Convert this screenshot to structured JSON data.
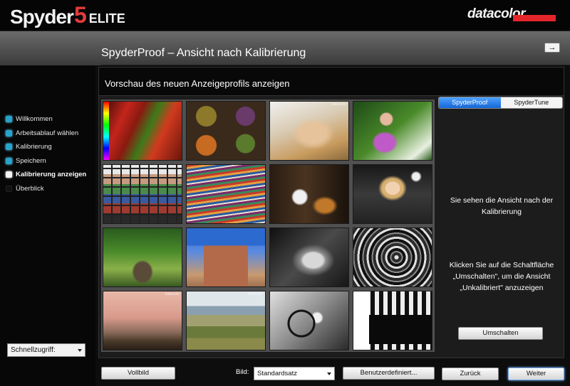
{
  "header": {
    "logo_word": "Spyder",
    "logo_number": "5",
    "logo_edition": "ELITE",
    "brand": "datacolor"
  },
  "titlebar": {
    "title": "SpyderProof – Ansicht nach Kalibrierung",
    "arrow_icon": "→"
  },
  "sidebar": {
    "steps": [
      {
        "label": "Willkommen",
        "state": "done"
      },
      {
        "label": "Arbeitsablauf wählen",
        "state": "done"
      },
      {
        "label": "Kalibrierung",
        "state": "done"
      },
      {
        "label": "Speichern",
        "state": "done"
      },
      {
        "label": "Kalibrierung anzeigen",
        "state": "current"
      },
      {
        "label": "Überblick",
        "state": "pending"
      }
    ],
    "quick_access": "Schnellzugriff:"
  },
  "main": {
    "subtitle": "Vorschau des neuen Anzeigeprofils anzeigen",
    "watermark": "datacolor"
  },
  "right_panel": {
    "tabs": [
      "SpyderProof",
      "SpyderTune"
    ],
    "active_tab": "SpyderProof",
    "info_1": "Sie sehen die Ansicht nach der Kalibrierung",
    "info_2": "Klicken Sie auf die Schaltfläche „Umschalten\", um die Ansicht „Unkalibriert\" anzuzeigen",
    "toggle_button": "Umschalten"
  },
  "footer": {
    "fullscreen_button": "Vollbild",
    "image_label": "Bild:",
    "image_select": "Standardsatz",
    "custom_button": "Benutzerdefiniert...",
    "back_button": "Zurück",
    "next_button": "Weiter"
  },
  "colors": {
    "accent_blue": "#1466d6",
    "brand_red": "#e4262a",
    "step_done": "#27a3c9"
  }
}
